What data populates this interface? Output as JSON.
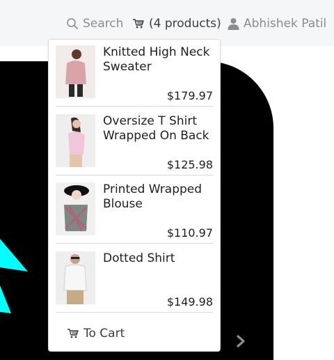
{
  "header": {
    "search_label": "Search",
    "cart_label": "(4 products)",
    "user_name": "Abhishek Patil"
  },
  "cart_dropdown": {
    "items": [
      {
        "name": "Knitted High Neck Sweater",
        "price": "$179.97"
      },
      {
        "name": "Oversize T Shirt Wrapped On Back",
        "price": "$125.98"
      },
      {
        "name": "Printed Wrapped Blouse",
        "price": "$110.97"
      },
      {
        "name": "Dotted Shirt",
        "price": "$149.98"
      }
    ],
    "to_cart_label": "To Cart"
  },
  "colors": {
    "topbar_bg": "#f5f6f8",
    "hero_bg": "#000000",
    "accent_cyan": "#00ffff",
    "muted_text": "#888c91"
  },
  "icons": {
    "search": "search-icon",
    "cart": "cart-icon",
    "user": "user-icon",
    "next": "chevron-right-icon"
  }
}
